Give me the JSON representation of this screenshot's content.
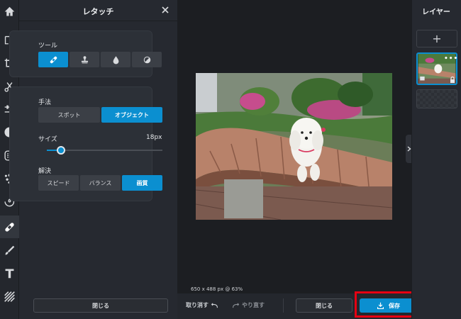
{
  "accent_color": "#0b8fd0",
  "highlight_color": "#e60012",
  "toolbar": {
    "icons": [
      "home-icon",
      "arrange-icon",
      "crop-icon",
      "cut-icon",
      "adjust-icon",
      "effects-icon",
      "filter-icon",
      "texture-icon",
      "spiral-icon",
      "retouch-icon",
      "draw-icon",
      "text-icon",
      "pattern-icon"
    ],
    "active": "retouch-icon"
  },
  "retouch_panel": {
    "title": "レタッチ",
    "tools": {
      "label": "ツール",
      "icons": [
        "bandage-icon",
        "stamp-icon",
        "drop-icon",
        "contrast-icon"
      ],
      "selected": "bandage-icon"
    },
    "method": {
      "label": "手法",
      "options": [
        "スポット",
        "オブジェクト"
      ],
      "selected": "オブジェクト"
    },
    "size": {
      "label": "サイズ",
      "value": "18px",
      "slider_level": 0.12
    },
    "resolution": {
      "label": "解決",
      "options": [
        "スピード",
        "バランス",
        "画質"
      ],
      "selected": "画質"
    },
    "close_label": "閉じる"
  },
  "canvas": {
    "size_info": "650 x 488 px @ 63%"
  },
  "bottom_bar": {
    "undo_label": "取り消す",
    "redo_label": "やり直す",
    "close_label": "閉じる",
    "save_label": "保存"
  },
  "layers_panel": {
    "title": "レイヤー",
    "add_label": "+",
    "more_label": "•••"
  }
}
